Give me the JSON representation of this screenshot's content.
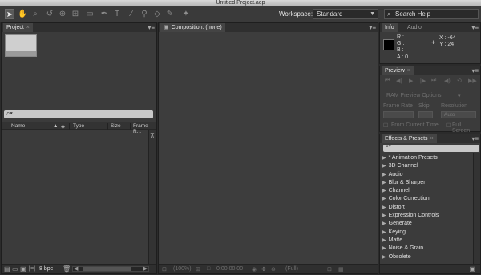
{
  "window": {
    "title": "Untitled Project.aep"
  },
  "toolbar": {
    "tools": [
      {
        "icon": "selection-arrow-icon",
        "glyph": "➤"
      },
      {
        "icon": "hand-icon",
        "glyph": "✋"
      },
      {
        "icon": "zoom-icon",
        "glyph": "⌕"
      },
      {
        "icon": "rotate-icon",
        "glyph": "↺"
      },
      {
        "icon": "camera-orbit-icon",
        "glyph": "⊕"
      },
      {
        "icon": "pan-behind-icon",
        "glyph": "⊞"
      },
      {
        "icon": "rectangle-mask-icon",
        "glyph": "▭"
      },
      {
        "icon": "pen-icon",
        "glyph": "✒"
      },
      {
        "icon": "type-icon",
        "glyph": "T"
      },
      {
        "icon": "brush-icon",
        "glyph": "∕"
      },
      {
        "icon": "clone-stamp-icon",
        "glyph": "⚲"
      },
      {
        "icon": "eraser-icon",
        "glyph": "◇"
      },
      {
        "icon": "roto-brush-icon",
        "glyph": "✎"
      },
      {
        "icon": "puppet-pin-icon",
        "glyph": "✦"
      }
    ],
    "workspace_label": "Workspace:",
    "workspace_value": "Standard",
    "search_help": "Search Help"
  },
  "project": {
    "tab": "Project",
    "columns": {
      "name": "Name",
      "type": "Type",
      "size": "Size",
      "frame_rate": "Frame R..."
    },
    "bpc": "8 bpc"
  },
  "composition": {
    "tab": "Composition: (none)",
    "zoom": "(100%)",
    "timecode": "0:00:00:00",
    "resolution": "(Full)"
  },
  "info": {
    "tabs": [
      "Info",
      "Audio"
    ],
    "r": "R :",
    "g": "G :",
    "b": "B :",
    "a": "A :  0",
    "x": "X : -64",
    "y": "Y : 24"
  },
  "preview": {
    "tab": "Preview",
    "ram_options": "RAM Preview Options",
    "frame_rate": "Frame Rate",
    "skip": "Skip",
    "resolution": "Resolution",
    "resolution_value": "Auto",
    "from_current_time": "From Current Time",
    "full_screen": "Full Screen"
  },
  "effects": {
    "tab": "Effects & Presets",
    "items": [
      "* Animation Presets",
      "3D Channel",
      "Audio",
      "Blur & Sharpen",
      "Channel",
      "Color Correction",
      "Distort",
      "Expression Controls",
      "Generate",
      "Keying",
      "Matte",
      "Noise & Grain",
      "Obsolete"
    ]
  }
}
